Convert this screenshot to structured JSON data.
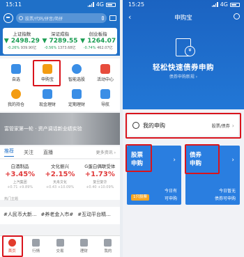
{
  "left": {
    "status": {
      "time": "15:11",
      "network": "4G"
    },
    "search": {
      "placeholder": "股票/代码/拼音/简拼"
    },
    "indices": [
      {
        "name": "上证指数",
        "value": "2498.29",
        "change": "-0.26%",
        "extra": "939.90亿",
        "trend": "down"
      },
      {
        "name": "深证成指",
        "value": "7289.55",
        "change": "-0.56%",
        "extra": "1373.68亿",
        "trend": "down"
      },
      {
        "name": "创业板指",
        "value": "1264.07",
        "change": "-0.74%",
        "extra": "462.07亿",
        "trend": "down"
      }
    ],
    "grid": [
      {
        "label": "自选",
        "icon": "star-icon",
        "color": "#3a8ee6"
      },
      {
        "label": "申购宝",
        "icon": "subscription-icon",
        "color": "#f39c12"
      },
      {
        "label": "智能选股",
        "icon": "smart-pick-icon",
        "color": "#3a8ee6"
      },
      {
        "label": "活动中心",
        "icon": "activity-icon",
        "color": "#e74c3c"
      },
      {
        "label": "我的持仓",
        "icon": "holdings-icon",
        "color": "#f39c12"
      },
      {
        "label": "现金理财",
        "icon": "cash-icon",
        "color": "#3a8ee6"
      },
      {
        "label": "定期理财",
        "icon": "fixed-finance-icon",
        "color": "#3a8ee6"
      },
      {
        "label": "导航",
        "icon": "nav-icon",
        "color": "#3a8ee6"
      }
    ],
    "banner": {
      "text": "富管家第一轮 · 资产调话新业绩实验"
    },
    "tabs": [
      "推荐",
      "关注",
      "直播"
    ],
    "more": "更多资讯",
    "funds": [
      {
        "title": "白酒制品",
        "pct": "+3.45%",
        "stock": "上汽集团",
        "sub": "+0.71 +9.89%"
      },
      {
        "title": "文化振兴",
        "pct": "+2.15%",
        "stock": "天舟文化",
        "sub": "+0.43 +10.09%"
      },
      {
        "title": "G蛋白偶联受体",
        "pct": "+1.73%",
        "stock": "复旦复华",
        "sub": "+0.40 +10.09%"
      }
    ],
    "hot_label": "热门主题",
    "topics": [
      "#人民币大新...",
      "#养老金入市#",
      "#互动平台精..."
    ],
    "tabbar": [
      "首页",
      "行情",
      "交易",
      "理财",
      "我的"
    ]
  },
  "right": {
    "status": {
      "time": "15:25",
      "network": "4G"
    },
    "nav": {
      "title": "申购宝",
      "back": "‹"
    },
    "hero": {
      "title": "轻松快速债券申购",
      "subtitle": "债券申购新规"
    },
    "my_subscription": {
      "label": "我的申购",
      "category": "股票/债券"
    },
    "stock_card": {
      "title_1": "股票",
      "title_2": "申购",
      "badge": "1只股票",
      "line1": "今日有",
      "line2": "可申购"
    },
    "bond_card": {
      "title_1": "债券",
      "title_2": "申购",
      "line1": "今日暂无",
      "line2": "债券可申购"
    }
  }
}
